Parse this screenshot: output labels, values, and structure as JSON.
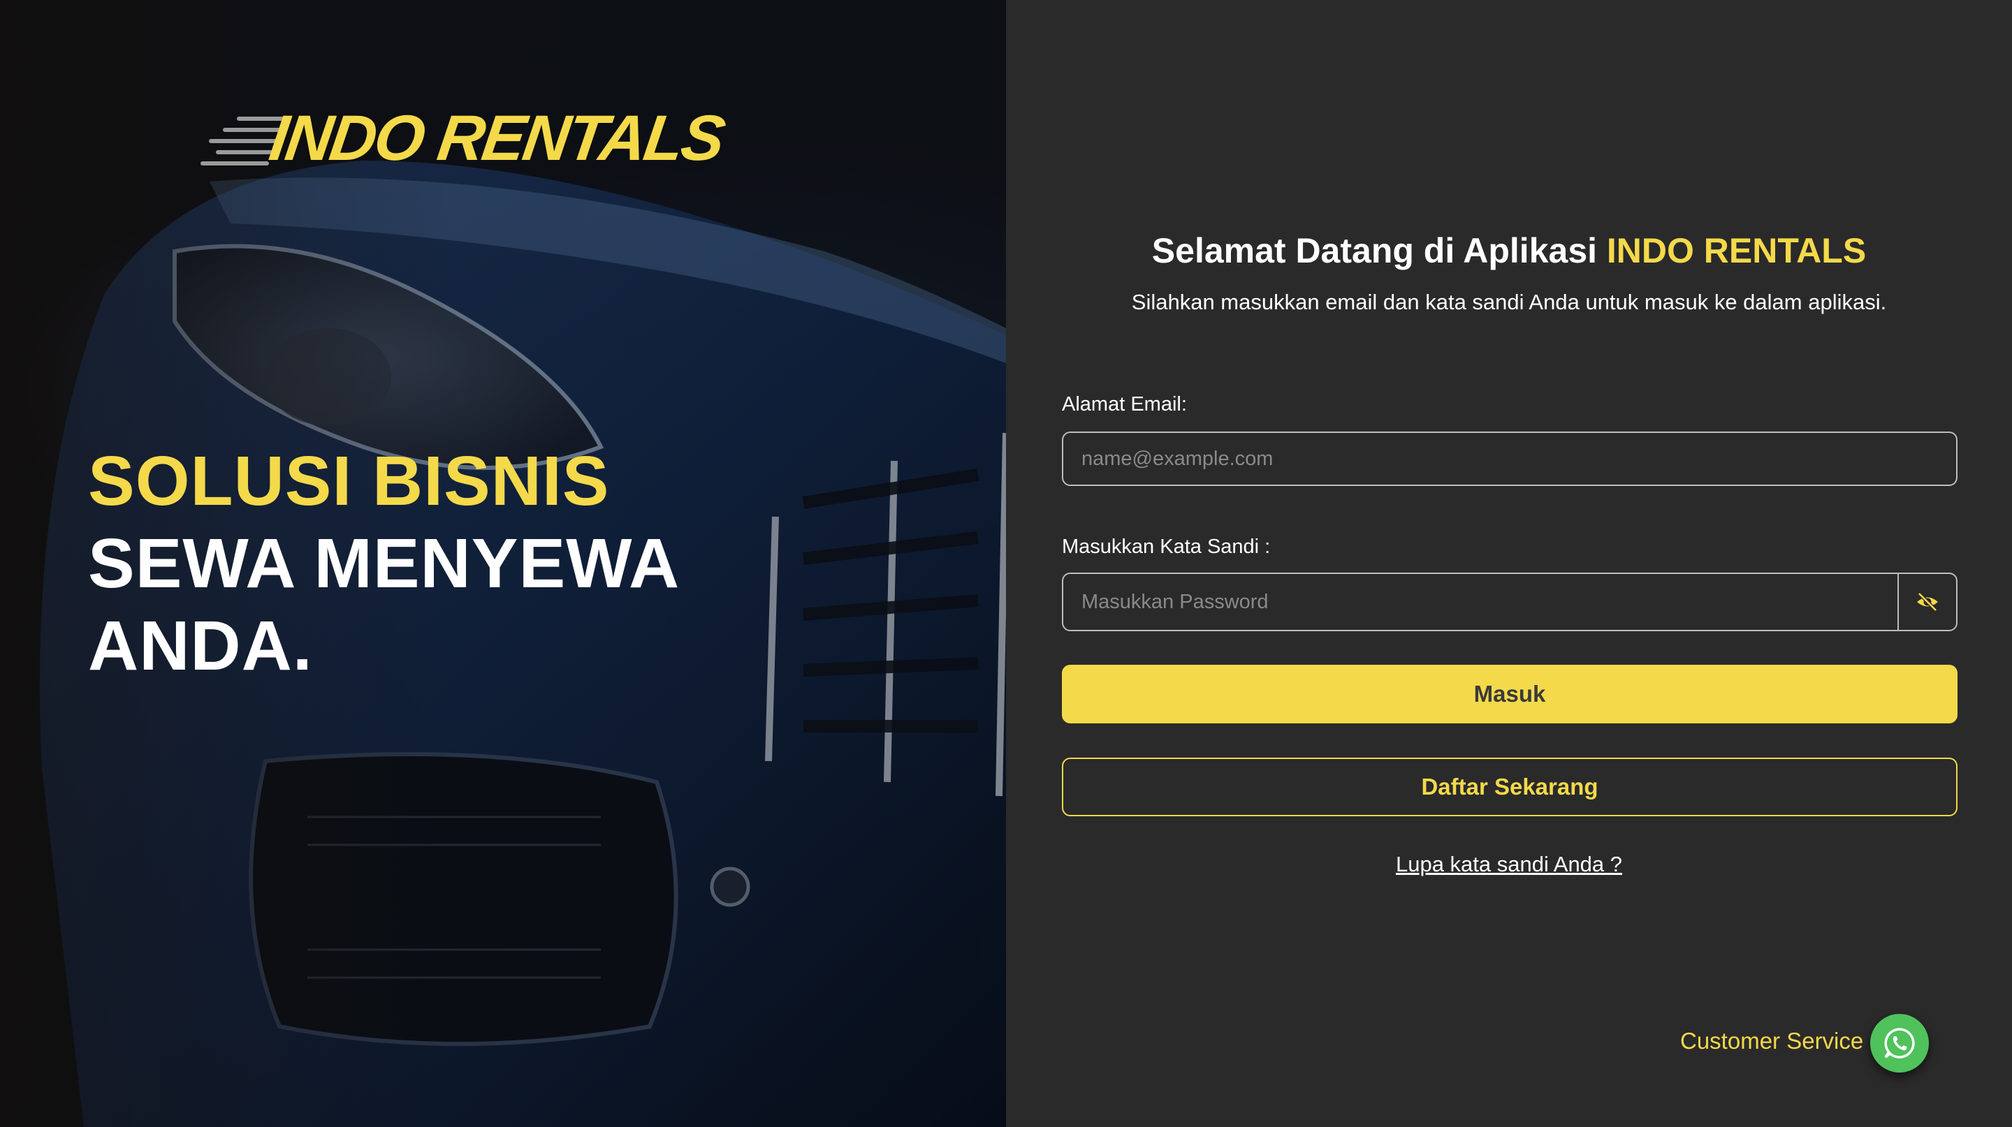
{
  "brand": {
    "logo_text": "INDO RENTALS",
    "color_accent": "#f4d94a"
  },
  "hero": {
    "tagline_line1": "SOLUSI BISNIS",
    "tagline_line2": "SEWA MENYEWA",
    "tagline_line3": "ANDA."
  },
  "login": {
    "welcome_prefix": "Selamat Datang di Aplikasi ",
    "welcome_brand": "INDO RENTALS",
    "subtitle": "Silahkan masukkan email dan kata sandi Anda untuk masuk ke dalam aplikasi.",
    "email_label": "Alamat Email:",
    "email_placeholder": "name@example.com",
    "password_label": "Masukkan Kata Sandi :",
    "password_placeholder": "Masukkan Password",
    "password_toggle_icon": "eye-slash-icon",
    "submit_label": "Masuk",
    "register_label": "Daftar Sekarang",
    "forgot_label": "Lupa kata sandi Anda ?"
  },
  "support": {
    "label": "Customer Service",
    "icon": "whatsapp-icon",
    "icon_color": "#4fc25b"
  }
}
